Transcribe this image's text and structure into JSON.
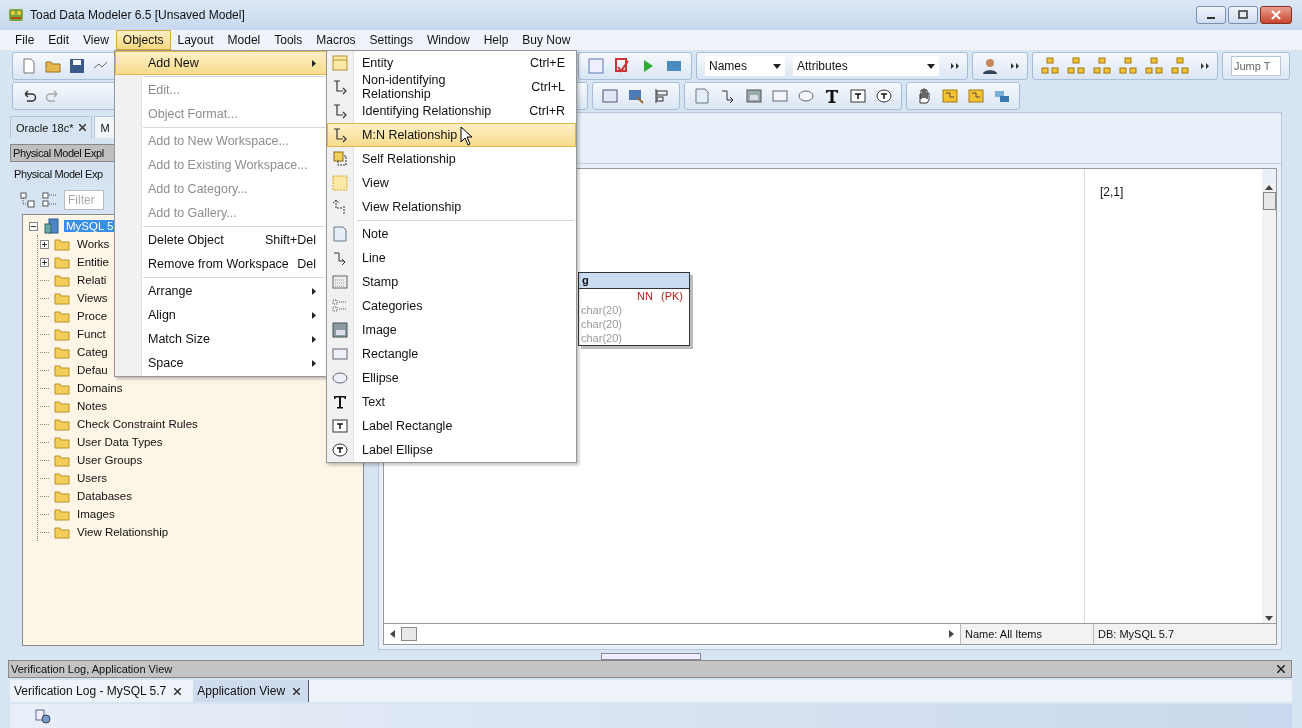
{
  "window": {
    "title": "Toad Data Modeler 6.5 [Unsaved Model]"
  },
  "menu_bar": [
    {
      "label": "File",
      "selected": false
    },
    {
      "label": "Edit",
      "selected": false
    },
    {
      "label": "View",
      "selected": false
    },
    {
      "label": "Objects",
      "selected": true
    },
    {
      "label": "Layout",
      "selected": false
    },
    {
      "label": "Model",
      "selected": false
    },
    {
      "label": "Tools",
      "selected": false
    },
    {
      "label": "Macros",
      "selected": false
    },
    {
      "label": "Settings",
      "selected": false
    },
    {
      "label": "Window",
      "selected": false
    },
    {
      "label": "Help",
      "selected": false
    },
    {
      "label": "Buy Now",
      "selected": false
    }
  ],
  "toolbar": {
    "view_combo": {
      "value": "Names"
    },
    "detail_combo": {
      "value": "Attributes"
    },
    "jump_field": {
      "placeholder": "Jump T"
    }
  },
  "left_panel": {
    "tabs": [
      {
        "label": "Oracle 18c*",
        "selected": false,
        "closable": true
      },
      {
        "label": "M",
        "selected": true,
        "closable": false
      }
    ],
    "explorer_header": "Physical Model Expl",
    "explorer_tab": "Physical Model Exp",
    "filter": {
      "placeholder": "Filter"
    },
    "tree": {
      "label": "MySQL 5",
      "selected": true,
      "expanded": true,
      "children": [
        {
          "label": "Works",
          "has_children": true
        },
        {
          "label": "Entitie",
          "has_children": true
        },
        {
          "label": "Relati",
          "has_children": false
        },
        {
          "label": "Views",
          "has_children": false
        },
        {
          "label": "Proce",
          "has_children": false
        },
        {
          "label": "Funct",
          "has_children": false
        },
        {
          "label": "Categ",
          "has_children": false
        },
        {
          "label": "Defau",
          "has_children": false
        },
        {
          "label": "Domains",
          "has_children": false
        },
        {
          "label": "Notes",
          "has_children": false
        },
        {
          "label": "Check Constraint Rules",
          "has_children": false
        },
        {
          "label": "User Data Types",
          "has_children": false
        },
        {
          "label": "User Groups",
          "has_children": false
        },
        {
          "label": "Users",
          "has_children": false
        },
        {
          "label": "Databases",
          "has_children": false
        },
        {
          "label": "Images",
          "has_children": false
        },
        {
          "label": "View Relationship",
          "has_children": false
        }
      ]
    }
  },
  "canvas": {
    "coords": "[2,1]",
    "entity": {
      "title": "g",
      "rows": [
        {
          "flags": "NN",
          "key": "(PK)"
        },
        {
          "type": "char(20)"
        },
        {
          "type": "char(20)"
        },
        {
          "type": "char(20)"
        }
      ]
    }
  },
  "status": {
    "name": "Name: All Items",
    "db": "DB: MySQL 5.7"
  },
  "objects_menu": [
    {
      "kind": "item",
      "label": "Add New",
      "disabled": false,
      "selected": true,
      "submenu": true
    },
    {
      "kind": "separator"
    },
    {
      "kind": "item",
      "label": "Edit...",
      "disabled": true,
      "selected": false,
      "submenu": false
    },
    {
      "kind": "item",
      "label": "Object Format...",
      "disabled": true,
      "selected": false,
      "submenu": false
    },
    {
      "kind": "separator"
    },
    {
      "kind": "item",
      "label": "Add to New Workspace...",
      "disabled": true,
      "selected": false,
      "submenu": false
    },
    {
      "kind": "item",
      "label": "Add to Existing Workspace...",
      "disabled": true,
      "selected": false,
      "submenu": false
    },
    {
      "kind": "item",
      "label": "Add to Category...",
      "disabled": true,
      "selected": false,
      "submenu": false
    },
    {
      "kind": "item",
      "label": "Add to Gallery...",
      "disabled": true,
      "selected": false,
      "submenu": false
    },
    {
      "kind": "separator"
    },
    {
      "kind": "item",
      "label": "Delete Object",
      "shortcut": "Shift+Del",
      "disabled": false,
      "selected": false,
      "submenu": false
    },
    {
      "kind": "item",
      "label": "Remove from Workspace",
      "shortcut": "Del",
      "disabled": false,
      "selected": false,
      "submenu": false
    },
    {
      "kind": "separator"
    },
    {
      "kind": "item",
      "label": "Arrange",
      "disabled": false,
      "selected": false,
      "submenu": true
    },
    {
      "kind": "item",
      "label": "Align",
      "disabled": false,
      "selected": false,
      "submenu": true
    },
    {
      "kind": "item",
      "label": "Match Size",
      "disabled": false,
      "selected": false,
      "submenu": true
    },
    {
      "kind": "item",
      "label": "Space",
      "disabled": false,
      "selected": false,
      "submenu": true
    }
  ],
  "add_new_submenu": [
    {
      "kind": "item",
      "label": "Entity",
      "shortcut": "Ctrl+E",
      "selected": false
    },
    {
      "kind": "item",
      "label": "Non-identifying Relationship",
      "shortcut": "Ctrl+L",
      "selected": false
    },
    {
      "kind": "item",
      "label": "Identifying Relationship",
      "shortcut": "Ctrl+R",
      "selected": false
    },
    {
      "kind": "item",
      "label": "M:N Relationship",
      "selected": true
    },
    {
      "kind": "item",
      "label": "Self Relationship",
      "selected": false
    },
    {
      "kind": "item",
      "label": "View",
      "selected": false
    },
    {
      "kind": "item",
      "label": "View Relationship",
      "selected": false
    },
    {
      "kind": "separator"
    },
    {
      "kind": "item",
      "label": "Note",
      "selected": false
    },
    {
      "kind": "item",
      "label": "Line",
      "selected": false
    },
    {
      "kind": "item",
      "label": "Stamp",
      "selected": false
    },
    {
      "kind": "item",
      "label": "Categories",
      "selected": false
    },
    {
      "kind": "item",
      "label": "Image",
      "selected": false
    },
    {
      "kind": "item",
      "label": "Rectangle",
      "selected": false
    },
    {
      "kind": "item",
      "label": "Ellipse",
      "selected": false
    },
    {
      "kind": "item",
      "label": "Text",
      "selected": false
    },
    {
      "kind": "item",
      "label": "Label Rectangle",
      "selected": false
    },
    {
      "kind": "item",
      "label": "Label Ellipse",
      "selected": false
    }
  ],
  "bottom_panel": {
    "title": "Verification Log, Application View",
    "tabs": [
      {
        "label": "Verification Log - MySQL 5.7",
        "selected": false
      },
      {
        "label": "Application View",
        "selected": true
      }
    ]
  }
}
